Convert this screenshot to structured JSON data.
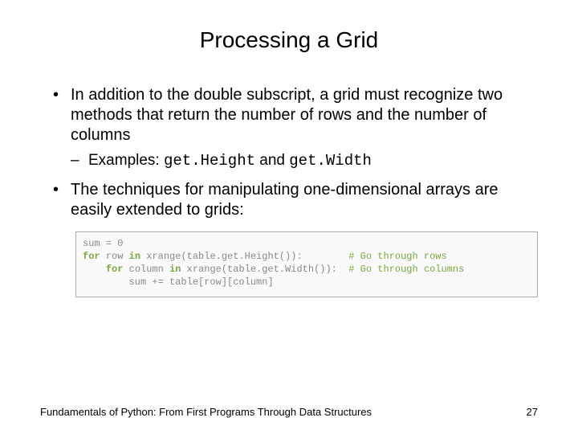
{
  "title": "Processing a Grid",
  "bullets": {
    "b1": "In addition to the double subscript, a grid must recognize two methods that return the number of rows and the number of columns",
    "b1_sub_prefix": "Examples: ",
    "b1_code1": "get.Height",
    "b1_and": " and ",
    "b1_code2": "get.Width",
    "b2": "The techniques for manipulating one-dimensional arrays are easily extended to grids:"
  },
  "code": {
    "l1a": "sum = 0",
    "l2_for": "for",
    "l2a": " row ",
    "l2_in": "in",
    "l2b": " xrange(table.get.Height()):        ",
    "l2c": "# Go through rows",
    "l3_pad": "    ",
    "l3_for": "for",
    "l3a": " column ",
    "l3_in": "in",
    "l3b": " xrange(table.get.Width()):  ",
    "l3c": "# Go through columns",
    "l4": "        sum += table[row][column]"
  },
  "footer": {
    "text": "Fundamentals of Python: From First Programs Through Data Structures",
    "page": "27"
  }
}
